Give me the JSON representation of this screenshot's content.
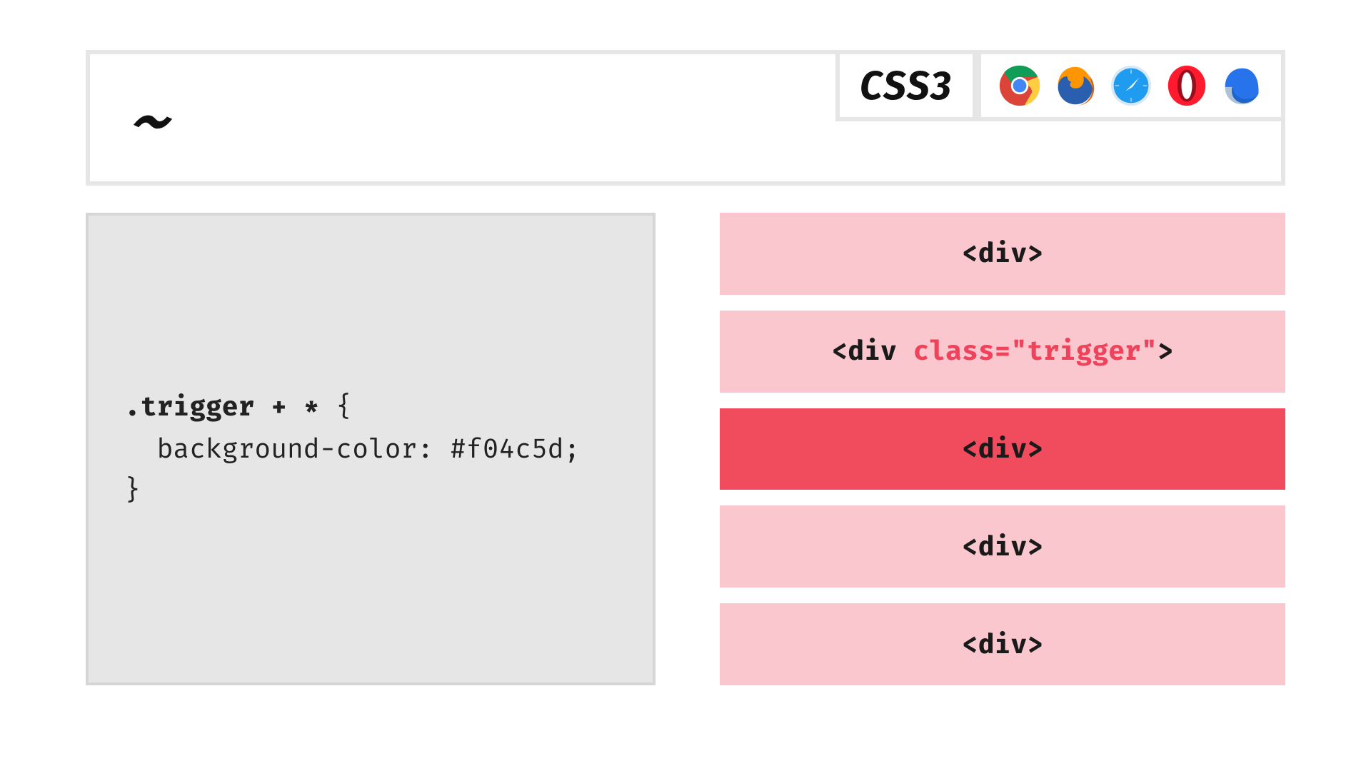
{
  "header": {
    "symbol": "~",
    "css_label": "CSS3",
    "browsers": [
      "chrome",
      "firefox",
      "safari",
      "opera",
      "edge"
    ]
  },
  "code": {
    "selector": ".trigger + *",
    "brace_open": " {",
    "rule": "  background-color: #f04c5d;",
    "brace_close": "}"
  },
  "demo": {
    "blocks": [
      {
        "label": "<div>",
        "selected": false,
        "highlight_attr": null
      },
      {
        "label": "<div class=\"trigger\">",
        "selected": false,
        "highlight_attr": "class=\"trigger\""
      },
      {
        "label": "<div>",
        "selected": true,
        "highlight_attr": null
      },
      {
        "label": "<div>",
        "selected": false,
        "highlight_attr": null
      },
      {
        "label": "<div>",
        "selected": false,
        "highlight_attr": null
      }
    ]
  }
}
